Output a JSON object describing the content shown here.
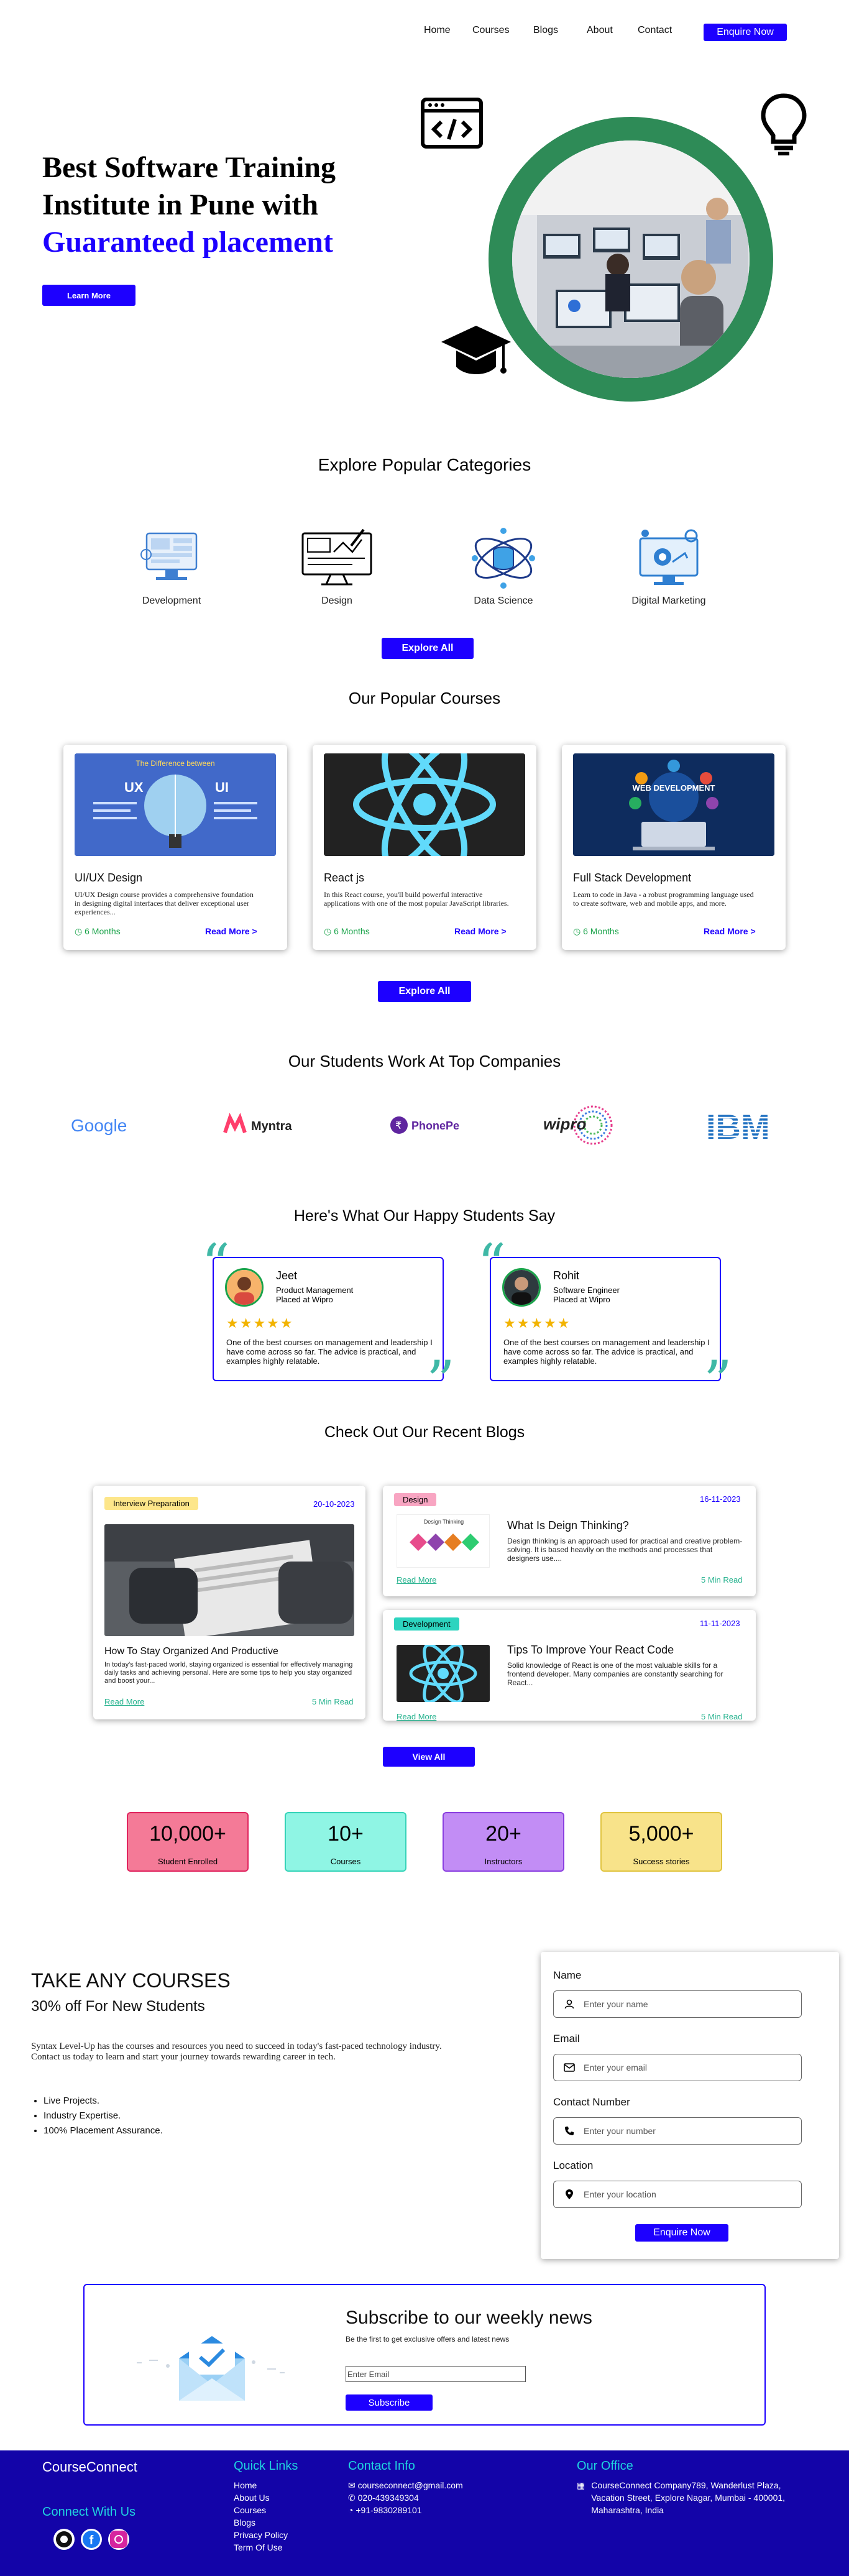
{
  "nav": {
    "items": [
      "Home",
      "Courses",
      "Blogs",
      "About",
      "Contact"
    ],
    "enquire": "Enquire Now"
  },
  "hero": {
    "line1": "Best Software Training",
    "line2": "Institute in Pune with",
    "line3": "Guaranteed placement",
    "cta": "Learn More"
  },
  "categories": {
    "title": "Explore Popular Categories",
    "items": [
      "Development",
      "Design",
      "Data Science",
      "Digital Marketing"
    ],
    "button": "Explore All"
  },
  "courses": {
    "title": "Our Popular Courses",
    "items": [
      {
        "title": "UI/UX Design",
        "desc": "UI/UX Design course provides a comprehensive foundation in designing digital interfaces that deliver exceptional user experiences...",
        "duration": "6 Months",
        "more": "Read More >",
        "img_heading": "The Difference between",
        "img_left": "UX",
        "img_right": "UI"
      },
      {
        "title": "React js",
        "desc": "In this React course, you'll build powerful interactive applications with one of the most popular JavaScript libraries.",
        "duration": "6 Months",
        "more": "Read More >"
      },
      {
        "title": "Full Stack Development",
        "desc": "Learn to code in Java - a robust programming language used to create software, web and mobile apps, and more.",
        "duration": "6 Months",
        "more": "Read More >",
        "img_heading": "WEB DEVELOPMENT"
      }
    ],
    "button": "Explore All"
  },
  "companies": {
    "title": "Our Students Work At Top Companies",
    "logos": [
      "Google",
      "Myntra",
      "PhonePe",
      "wipro",
      "IBM"
    ]
  },
  "testimonials": {
    "title": "Here's What Our Happy Students Say",
    "items": [
      {
        "name": "Jeet",
        "role": "Product Management",
        "placed": "Placed at Wipro",
        "stars": "★★★★★",
        "text": "One of the best courses on management and leadership I have come across so far. The advice is practical, and examples highly relatable."
      },
      {
        "name": "Rohit",
        "role": "Software Engineer",
        "placed": "Placed at Wipro",
        "stars": "★★★★★",
        "text": "One of the best courses on management and leadership I have come across so far. The advice is practical, and examples highly relatable."
      }
    ]
  },
  "blogs": {
    "title": "Check Out Our Recent Blogs",
    "main": {
      "tag": "Interview Preparation",
      "date": "20-10-2023",
      "title": "How To Stay Organized And Productive",
      "desc": "In today's fast-paced world, staying organized is essential for effectively managing daily tasks and achieving personal. Here are some tips to help you stay organized and boost your...",
      "read": "Read More",
      "time": "5 Min Read"
    },
    "side": [
      {
        "tag": "Design",
        "date": "16-11-2023",
        "title": "What Is Deign Thinking?",
        "desc": "Design thinking is an approach used for practical and creative problem-solving. It is based heavily on the methods and processes that designers use....",
        "read": "Read More",
        "time": "5 Min Read",
        "img_label": "Design Thinking"
      },
      {
        "tag": "Development",
        "date": "11-11-2023",
        "title": "Tips To Improve Your React Code",
        "desc": "Solid knowledge of React is one of the most valuable skills for a frontend developer. Many companies are constantly searching for React...",
        "read": "Read More",
        "time": "5 Min Read"
      }
    ],
    "button": "View All"
  },
  "stats": [
    {
      "value": "10,000+",
      "label": "Student Enrolled",
      "bg": "#f47a97",
      "border": "#e0245e"
    },
    {
      "value": "10+",
      "label": "Courses",
      "bg": "#8ff5e4",
      "border": "#35d3b8"
    },
    {
      "value": "20+",
      "label": "Instructors",
      "bg": "#c28df5",
      "border": "#8a3fe0"
    },
    {
      "value": "5,000+",
      "label": "Success stories",
      "bg": "#f8e38a",
      "border": "#e0c440"
    }
  ],
  "offer": {
    "title": "TAKE ANY COURSES",
    "subtitle": "30% off For New Students",
    "desc1": "Syntax Level-Up has the courses and resources you need to succeed in today's fast-paced technology industry.",
    "desc2": "Contact us today to learn and start your journey towards rewarding career in tech.",
    "points": [
      "Live Projects.",
      "Industry Expertise.",
      "100% Placement Assurance."
    ]
  },
  "form": {
    "name_label": "Name",
    "name_ph": "Enter your name",
    "email_label": "Email",
    "email_ph": "Enter your email",
    "phone_label": "Contact Number",
    "phone_ph": "Enter your number",
    "loc_label": "Location",
    "loc_ph": "Enter your location",
    "submit": "Enquire Now"
  },
  "subscribe": {
    "title": "Subscribe to our weekly news",
    "sub": "Be the first to get exclusive offers and latest news",
    "ph": "Enter Email",
    "button": "Subscribe"
  },
  "footer": {
    "brand": "CourseConnect",
    "connect": "Connect With Us",
    "quick_title": "Quick Links",
    "quick": [
      "Home",
      "About Us",
      "Courses",
      "Blogs",
      "Privacy Policy",
      "Term Of Use"
    ],
    "contact_title": "Contact Info",
    "email": "courseconnect@gmail.com",
    "phone": "020-439349304",
    "whatsapp": "+91-9830289101",
    "office_title": "Our Office",
    "address": "CourseConnect Company789, Wanderlust Plaza, Vacation Street, Explore Nagar, Mumbai - 400001, Maharashtra, India"
  },
  "colors": {
    "brand_blue": "#1d00ff",
    "footer_bg": "#1304a8",
    "green": "#2e8b57"
  }
}
